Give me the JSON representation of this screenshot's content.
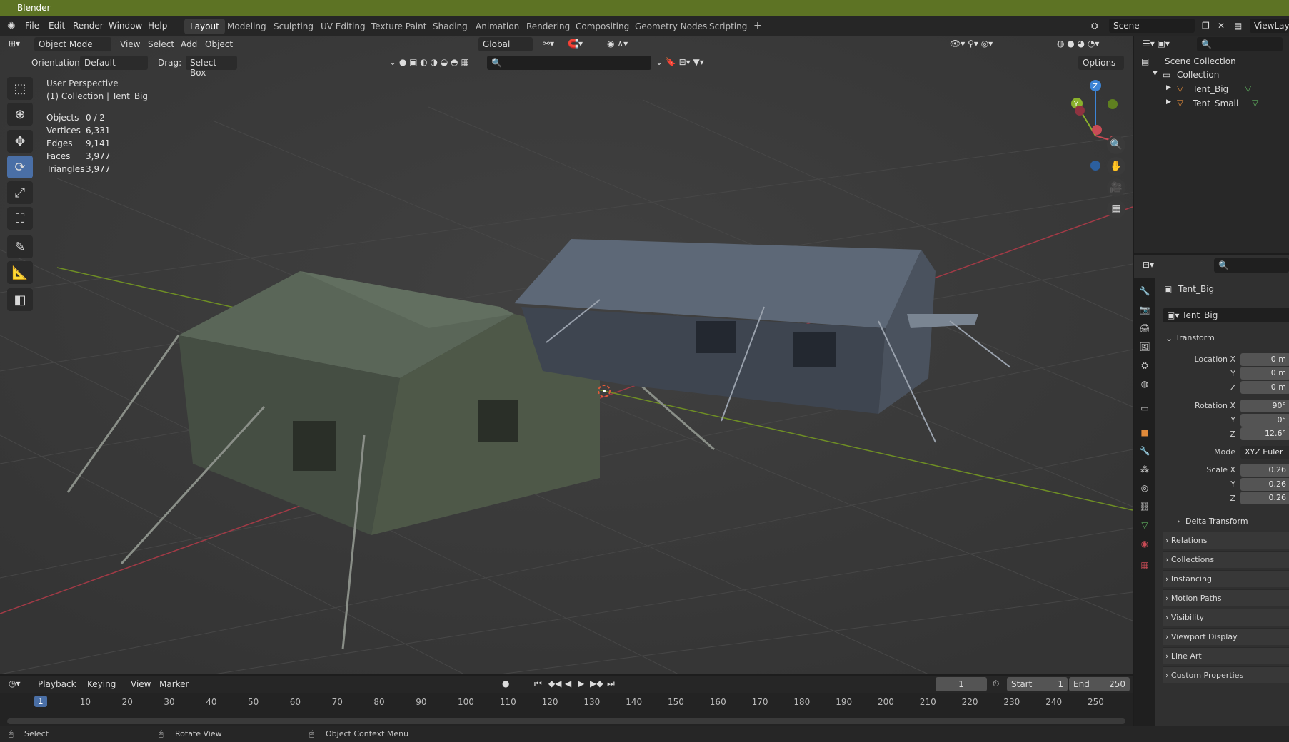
{
  "app": {
    "title": "Blender"
  },
  "menu": [
    "File",
    "Edit",
    "Render",
    "Window",
    "Help"
  ],
  "workspaces": [
    "Layout",
    "Modeling",
    "Sculpting",
    "UV Editing",
    "Texture Paint",
    "Shading",
    "Animation",
    "Rendering",
    "Compositing",
    "Geometry Nodes",
    "Scripting"
  ],
  "scene": {
    "label": "Scene",
    "viewlayer": "ViewLaye"
  },
  "viewport_header": {
    "mode": "Object Mode",
    "view": "View",
    "select": "Select",
    "add": "Add",
    "object": "Object",
    "orientation_label": "Orientation:",
    "orientation_value": "Default",
    "drag_label": "Drag:",
    "drag_value": "Select Box",
    "transform": "Global",
    "options": "Options"
  },
  "overlay": {
    "perspective": "User Perspective",
    "collection": "(1) Collection | Tent_Big",
    "stats": [
      {
        "label": "Objects",
        "value": "0 / 2"
      },
      {
        "label": "Vertices",
        "value": "6,331"
      },
      {
        "label": "Edges",
        "value": "9,141"
      },
      {
        "label": "Faces",
        "value": "3,977"
      },
      {
        "label": "Triangles",
        "value": "3,977"
      }
    ]
  },
  "outliner": {
    "scene_collection": "Scene Collection",
    "collection": "Collection",
    "items": [
      "Tent_Big",
      "Tent_Small"
    ]
  },
  "properties": {
    "object_name": "Tent_Big",
    "data_name": "Tent_Big",
    "transform_title": "Transform",
    "location": {
      "x_label": "Location X",
      "y_label": "Y",
      "z_label": "Z",
      "x": "0 m",
      "y": "0 m",
      "z": "0 m"
    },
    "rotation": {
      "x_label": "Rotation X",
      "y_label": "Y",
      "z_label": "Z",
      "x": "90°",
      "y": "0°",
      "z": "12.6°"
    },
    "mode_label": "Mode",
    "mode_value": "XYZ Euler",
    "scale": {
      "x_label": "Scale X",
      "y_label": "Y",
      "z_label": "Z",
      "x": "0.26",
      "y": "0.26",
      "z": "0.26"
    },
    "delta": "Delta Transform",
    "panels": [
      "Relations",
      "Collections",
      "Instancing",
      "Motion Paths",
      "Visibility",
      "Viewport Display",
      "Line Art",
      "Custom Properties"
    ]
  },
  "timeline": {
    "playback": "Playback",
    "keying": "Keying",
    "view": "View",
    "marker": "Marker",
    "current_frame": "1",
    "start_label": "Start",
    "start": "1",
    "end_label": "End",
    "end": "250",
    "ticks": [
      "1",
      "10",
      "20",
      "30",
      "40",
      "50",
      "60",
      "70",
      "80",
      "90",
      "100",
      "110",
      "120",
      "130",
      "140",
      "150",
      "160",
      "170",
      "180",
      "190",
      "200",
      "210",
      "220",
      "230",
      "240",
      "250"
    ]
  },
  "status": {
    "select": "Select",
    "rotate": "Rotate View",
    "context": "Object Context Menu"
  },
  "colors": {
    "titlebar": "#5d7324",
    "accent": "#4a6fa6",
    "x_axis": "#c84b55",
    "y_axis": "#8ab02c",
    "z_axis": "#3c84d6"
  }
}
